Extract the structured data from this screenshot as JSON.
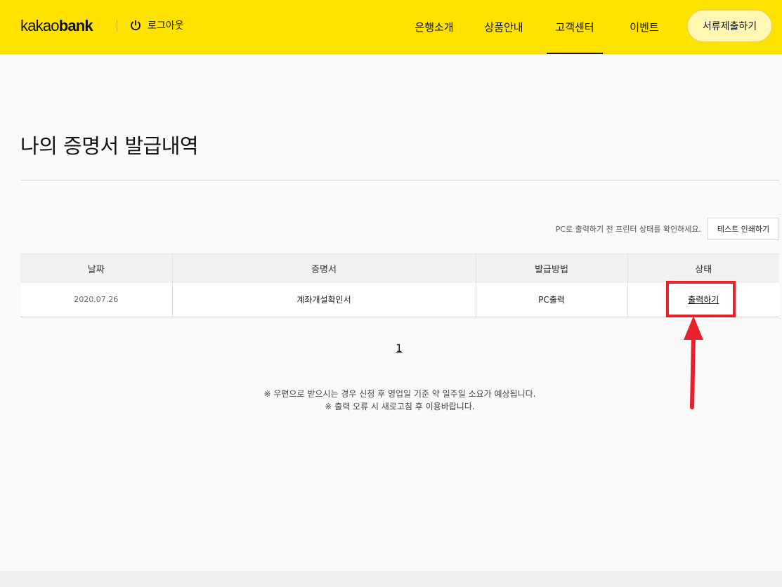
{
  "header": {
    "logo_light": "kakao",
    "logo_bold": "bank",
    "logout_label": "로그아웃",
    "nav": [
      {
        "label": "은행소개"
      },
      {
        "label": "상품안내"
      },
      {
        "label": "고객센터",
        "active": true
      },
      {
        "label": "이벤트"
      }
    ],
    "submit_label": "서류제출하기"
  },
  "main": {
    "title": "나의 증명서 발급내역",
    "printer_note": "PC로 출력하기 전 프린터 상태를 확인하세요.",
    "test_print_label": "테스트 인쇄하기",
    "table": {
      "headers": [
        "날짜",
        "증명서",
        "발급방법",
        "상태"
      ],
      "rows": [
        {
          "date": "2020.07.26",
          "certificate": "계좌개설확인서",
          "method": "PC출력",
          "status": "출력하기"
        }
      ]
    },
    "pagination": {
      "current": "1"
    },
    "notes": [
      "※ 우편으로 받으시는 경우 신청 후 영업일 기준 약 일주일 소요가 예상됩니다.",
      "※ 출력 오류 시 새로고침 후 이용바랍니다."
    ]
  },
  "colors": {
    "header_bg": "#ffe300",
    "highlight": "#e8202a"
  },
  "icons": {
    "logout": "power-icon"
  }
}
